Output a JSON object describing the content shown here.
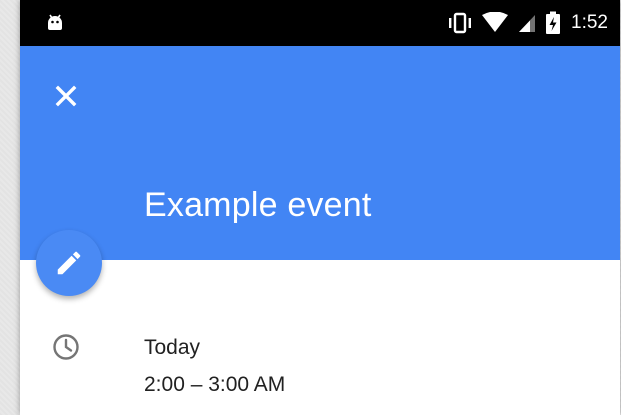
{
  "status_bar": {
    "time": "1:52",
    "icons": [
      "android-debug-icon",
      "vibrate-icon",
      "wifi-icon",
      "signal-icon",
      "battery-charging-icon"
    ]
  },
  "app_bar": {
    "close_icon": "close-icon",
    "title": "Example event",
    "color": "#4285f4"
  },
  "fab": {
    "icon": "edit-pencil-icon",
    "color": "#4a8af4"
  },
  "event_details": {
    "icon": "clock-icon",
    "date": "Today",
    "time_range": "2:00 – 3:00 AM"
  }
}
